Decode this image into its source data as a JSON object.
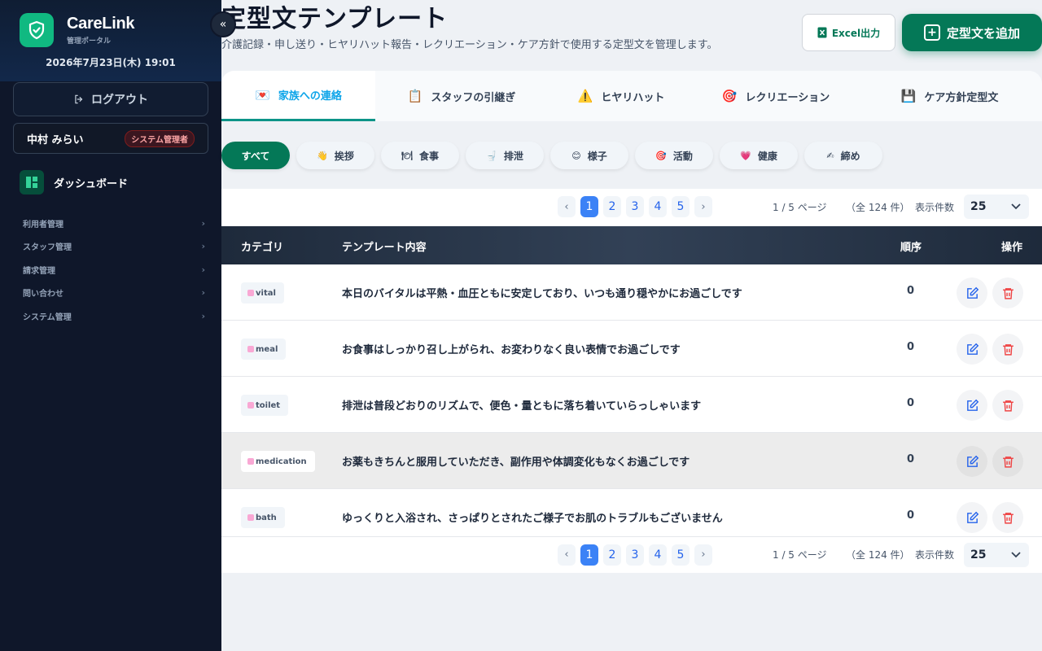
{
  "brand": {
    "name": "CareLink",
    "subtitle": "管理ポータル",
    "datetime": "2026年7月23日(木) 19:01"
  },
  "sidebar": {
    "logout_label": "ログアウト",
    "user": {
      "name": "中村 みらい",
      "role": "システム管理者"
    },
    "dashboard_label": "ダッシュボード",
    "items": [
      {
        "label": "利用者管理"
      },
      {
        "label": "スタッフ管理"
      },
      {
        "label": "請求管理"
      },
      {
        "label": "問い合わせ"
      },
      {
        "label": "システム管理"
      }
    ]
  },
  "header": {
    "title": "定型文テンプレート",
    "description": "介護記録・申し送り・ヒヤリハット報告・レクリエーション・ケア方針で使用する定型文を管理します。",
    "excel_label": "Excel出力",
    "add_label": "定型文を追加"
  },
  "tabs": [
    {
      "label": "家族への連絡",
      "icon": "💌"
    },
    {
      "label": "スタッフの引継ぎ",
      "icon": "📋"
    },
    {
      "label": "ヒヤリハット",
      "icon": "⚠️"
    },
    {
      "label": "レクリエーション",
      "icon": "🎯"
    },
    {
      "label": "ケア方針定型文",
      "icon": "💾"
    }
  ],
  "chips": [
    {
      "label": "すべて",
      "icon": ""
    },
    {
      "label": "挨拶",
      "icon": "👋"
    },
    {
      "label": "食事",
      "icon": "🍽"
    },
    {
      "label": "排泄",
      "icon": "🚽"
    },
    {
      "label": "様子",
      "icon": "😊"
    },
    {
      "label": "活動",
      "icon": "🎯"
    },
    {
      "label": "健康",
      "icon": "💗"
    },
    {
      "label": "締め",
      "icon": "✍"
    }
  ],
  "pagination": {
    "pages": [
      "1",
      "2",
      "3",
      "4",
      "5"
    ],
    "current": "1",
    "prev": "‹",
    "next": "›",
    "info": "1 / 5 ページ",
    "total": "（全 124 件）",
    "size_label": "表示件数",
    "size_value": "25"
  },
  "table": {
    "headers": {
      "category": "カテゴリ",
      "content": "テンプレート内容",
      "order": "順序",
      "actions": "操作"
    },
    "rows": [
      {
        "category": "vital",
        "content": "本日のバイタルは平熱・血圧ともに安定しており、いつも通り穏やかにお過ごしです",
        "order": "0"
      },
      {
        "category": "meal",
        "content": "お食事はしっかり召し上がられ、お変わりなく良い表情でお過ごしです",
        "order": "0"
      },
      {
        "category": "toilet",
        "content": "排泄は普段どおりのリズムで、便色・量ともに落ち着いていらっしゃいます",
        "order": "0"
      },
      {
        "category": "medication",
        "content": "お薬もきちんと服用していただき、副作用や体調変化もなくお過ごしです",
        "order": "0"
      },
      {
        "category": "bath",
        "content": "ゆっくりと入浴され、さっぱりとされたご様子でお肌のトラブルもございません",
        "order": "0"
      }
    ]
  },
  "colors": {
    "accent": "#047857",
    "active_tab": "#0ea5e9",
    "page_active": "#3b82f6",
    "sidebar_bg": "#0f172a"
  }
}
